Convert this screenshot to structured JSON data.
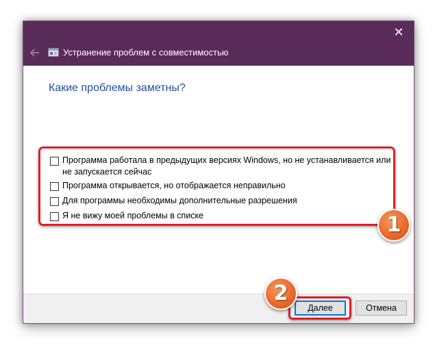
{
  "window": {
    "title": "Устранение проблем с совместимостью",
    "close_icon": "✕",
    "back_icon": "arrow-left-icon",
    "app_icon": "troubleshooter-icon",
    "titlebar_color": "#5a2c59"
  },
  "main": {
    "heading": "Какие проблемы заметны?",
    "options": [
      {
        "label": "Программа работала в предыдущих версиях Windows, но не устанавливается или не запускается сейчас",
        "checked": false
      },
      {
        "label": "Программа открывается, но отображается неправильно",
        "checked": false
      },
      {
        "label": "Для программы необходимы дополнительные разрешения",
        "checked": false
      },
      {
        "label": "Я не вижу моей проблемы в списке",
        "checked": false
      }
    ]
  },
  "footer": {
    "next_label": "Далее",
    "cancel_label": "Отмена"
  },
  "annotations": {
    "callout_1": "1",
    "callout_2": "2",
    "highlight_color": "#e31c25",
    "callout_color": "#ea6a2c"
  }
}
